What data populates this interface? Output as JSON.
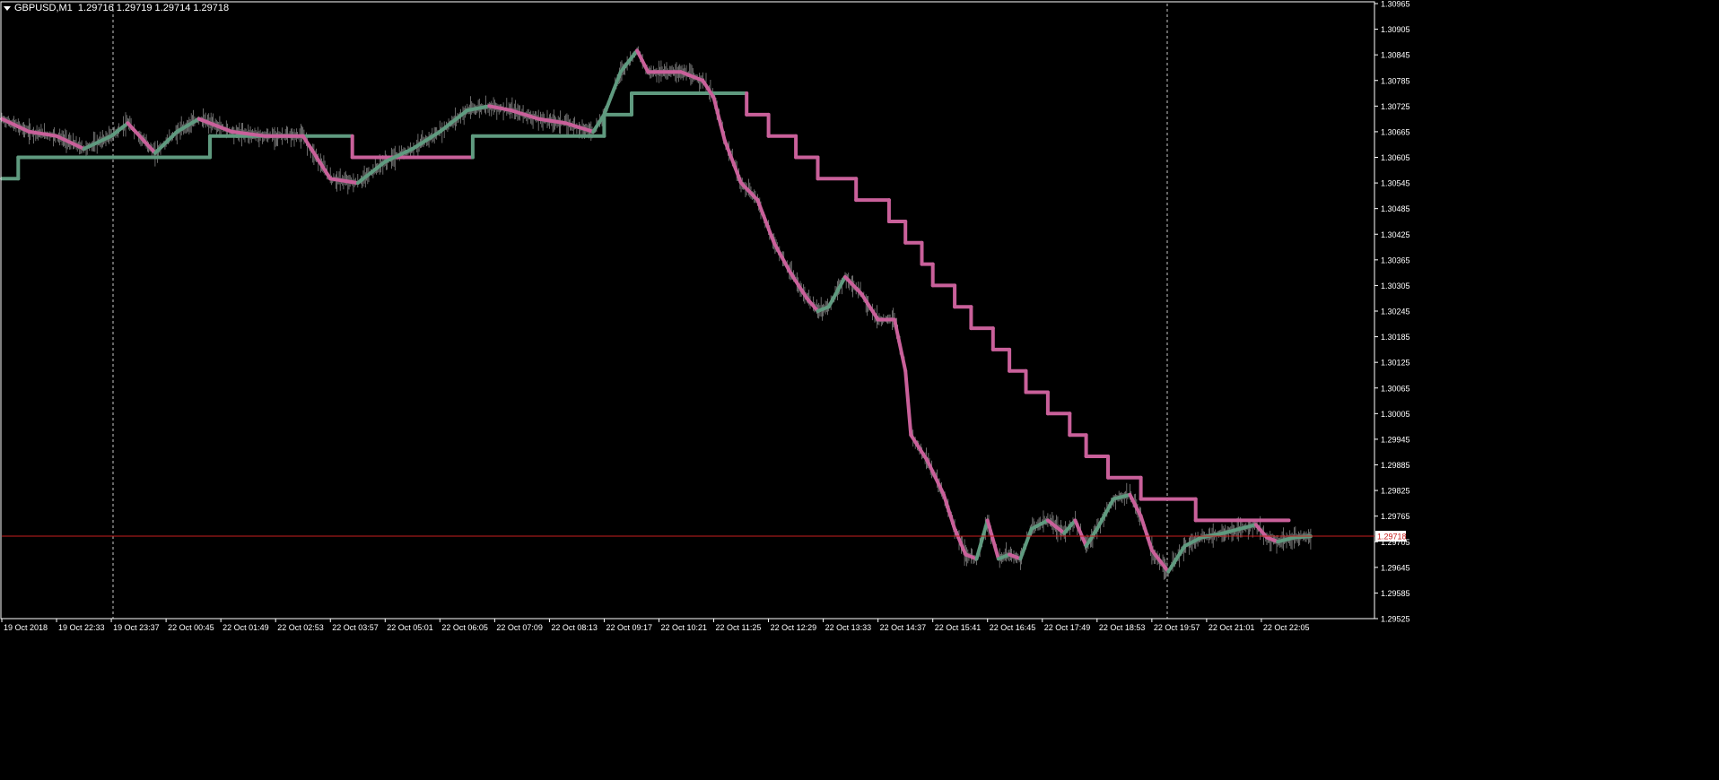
{
  "header": {
    "symbol": "GBPUSD,M1",
    "quotes": "1.29716 1.29719 1.29714 1.29718"
  },
  "price_label": "1.29718",
  "colors": {
    "background": "#000000",
    "axis": "#ffffff",
    "text": "#ffffff",
    "grid_vertical": "#c8c8c8",
    "bid_line": "#c81e1e",
    "price_tag_bg": "#ffffff",
    "price_tag_text": "#c81e1e",
    "series_up": "#5f9a7f",
    "series_down": "#c9609a",
    "price_ticks": "#9a9a9a"
  },
  "chart_data": {
    "type": "line",
    "title": "",
    "xlabel": "",
    "ylabel": "",
    "ylim": [
      1.29525,
      1.30965
    ],
    "x_ticks": [
      "19 Oct 2018",
      "19 Oct 22:33",
      "19 Oct 23:37",
      "22 Oct 00:45",
      "22 Oct 01:49",
      "22 Oct 02:53",
      "22 Oct 03:57",
      "22 Oct 05:01",
      "22 Oct 06:05",
      "22 Oct 07:09",
      "22 Oct 08:13",
      "22 Oct 09:17",
      "22 Oct 10:21",
      "22 Oct 11:25",
      "22 Oct 12:29",
      "22 Oct 13:33",
      "22 Oct 14:37",
      "22 Oct 15:41",
      "22 Oct 16:45",
      "22 Oct 17:49",
      "22 Oct 18:53",
      "22 Oct 19:57",
      "22 Oct 21:01",
      "22 Oct 22:05"
    ],
    "y_ticks": [
      "1.30965",
      "1.30905",
      "1.30845",
      "1.30785",
      "1.30725",
      "1.30665",
      "1.30605",
      "1.30545",
      "1.30485",
      "1.30425",
      "1.30365",
      "1.30305",
      "1.30245",
      "1.30185",
      "1.30125",
      "1.30065",
      "1.30005",
      "1.29945",
      "1.29885",
      "1.29825",
      "1.29765",
      "1.29705",
      "1.29645",
      "1.29585",
      "1.29525"
    ],
    "current_price": 1.29718,
    "series": [
      {
        "role": "slow-stepped-line",
        "points": [
          [
            0,
            1.30555
          ],
          [
            0.3,
            1.30555
          ],
          [
            0.3,
            1.30605
          ],
          [
            3.8,
            1.30605
          ],
          [
            3.8,
            1.30655
          ],
          [
            6.4,
            1.30655
          ],
          [
            6.4,
            1.30605
          ],
          [
            8.6,
            1.30605
          ],
          [
            8.6,
            1.30655
          ],
          [
            11.0,
            1.30655
          ],
          [
            11.0,
            1.30705
          ],
          [
            11.5,
            1.30705
          ],
          [
            11.5,
            1.30755
          ],
          [
            13.6,
            1.30755
          ],
          [
            13.6,
            1.30705
          ],
          [
            14.0,
            1.30705
          ],
          [
            14.0,
            1.30655
          ],
          [
            14.5,
            1.30655
          ],
          [
            14.5,
            1.30605
          ],
          [
            14.9,
            1.30605
          ],
          [
            14.9,
            1.30555
          ],
          [
            15.6,
            1.30555
          ],
          [
            15.6,
            1.30505
          ],
          [
            16.2,
            1.30505
          ],
          [
            16.2,
            1.30455
          ],
          [
            16.5,
            1.30455
          ],
          [
            16.5,
            1.30405
          ],
          [
            16.8,
            1.30405
          ],
          [
            16.8,
            1.30355
          ],
          [
            17.0,
            1.30355
          ],
          [
            17.0,
            1.30305
          ],
          [
            17.4,
            1.30305
          ],
          [
            17.4,
            1.30255
          ],
          [
            17.7,
            1.30255
          ],
          [
            17.7,
            1.30205
          ],
          [
            18.1,
            1.30205
          ],
          [
            18.1,
            1.30155
          ],
          [
            18.4,
            1.30155
          ],
          [
            18.4,
            1.30105
          ],
          [
            18.7,
            1.30105
          ],
          [
            18.7,
            1.30055
          ],
          [
            19.1,
            1.30055
          ],
          [
            19.1,
            1.30005
          ],
          [
            19.5,
            1.30005
          ],
          [
            19.5,
            1.29955
          ],
          [
            19.8,
            1.29955
          ],
          [
            19.8,
            1.29905
          ],
          [
            20.2,
            1.29905
          ],
          [
            20.2,
            1.29855
          ],
          [
            20.8,
            1.29855
          ],
          [
            20.8,
            1.29805
          ],
          [
            21.8,
            1.29805
          ],
          [
            21.8,
            1.29755
          ],
          [
            23.5,
            1.29755
          ]
        ]
      },
      {
        "role": "fast-line",
        "points": [
          [
            0,
            1.30695
          ],
          [
            0.5,
            1.30665
          ],
          [
            1.0,
            1.30655
          ],
          [
            1.5,
            1.30625
          ],
          [
            2.0,
            1.30655
          ],
          [
            2.3,
            1.30685
          ],
          [
            2.8,
            1.30615
          ],
          [
            3.2,
            1.30665
          ],
          [
            3.6,
            1.30695
          ],
          [
            4.2,
            1.30665
          ],
          [
            4.8,
            1.30655
          ],
          [
            5.5,
            1.30655
          ],
          [
            5.8,
            1.30595
          ],
          [
            6.0,
            1.30555
          ],
          [
            6.5,
            1.30545
          ],
          [
            7.0,
            1.30595
          ],
          [
            7.5,
            1.30625
          ],
          [
            8.0,
            1.30665
          ],
          [
            8.5,
            1.30715
          ],
          [
            8.9,
            1.30725
          ],
          [
            9.3,
            1.30715
          ],
          [
            9.8,
            1.30695
          ],
          [
            10.3,
            1.30685
          ],
          [
            10.8,
            1.30665
          ],
          [
            11.0,
            1.30705
          ],
          [
            11.3,
            1.30805
          ],
          [
            11.6,
            1.30855
          ],
          [
            11.8,
            1.30805
          ],
          [
            12.4,
            1.30805
          ],
          [
            12.8,
            1.30785
          ],
          [
            13.0,
            1.30745
          ],
          [
            13.2,
            1.30645
          ],
          [
            13.5,
            1.30545
          ],
          [
            13.8,
            1.30505
          ],
          [
            14.1,
            1.30405
          ],
          [
            14.4,
            1.30335
          ],
          [
            14.7,
            1.30275
          ],
          [
            14.9,
            1.30245
          ],
          [
            15.1,
            1.30255
          ],
          [
            15.4,
            1.30325
          ],
          [
            15.7,
            1.30285
          ],
          [
            16.0,
            1.30225
          ],
          [
            16.3,
            1.30225
          ],
          [
            16.5,
            1.30105
          ],
          [
            16.6,
            1.29955
          ],
          [
            16.9,
            1.29895
          ],
          [
            17.2,
            1.29815
          ],
          [
            17.4,
            1.29735
          ],
          [
            17.6,
            1.29675
          ],
          [
            17.8,
            1.29665
          ],
          [
            18.0,
            1.29755
          ],
          [
            18.2,
            1.29665
          ],
          [
            18.4,
            1.29675
          ],
          [
            18.6,
            1.29665
          ],
          [
            18.8,
            1.29735
          ],
          [
            19.1,
            1.29755
          ],
          [
            19.4,
            1.29725
          ],
          [
            19.6,
            1.29755
          ],
          [
            19.8,
            1.29695
          ],
          [
            20.0,
            1.29735
          ],
          [
            20.3,
            1.29805
          ],
          [
            20.6,
            1.29815
          ],
          [
            20.8,
            1.29765
          ],
          [
            21.0,
            1.29685
          ],
          [
            21.3,
            1.29635
          ],
          [
            21.6,
            1.29695
          ],
          [
            21.9,
            1.29715
          ],
          [
            22.3,
            1.29725
          ],
          [
            22.6,
            1.29735
          ],
          [
            22.9,
            1.29745
          ],
          [
            23.1,
            1.29715
          ],
          [
            23.3,
            1.29705
          ],
          [
            23.6,
            1.29715
          ],
          [
            23.9,
            1.29718
          ]
        ]
      }
    ]
  }
}
